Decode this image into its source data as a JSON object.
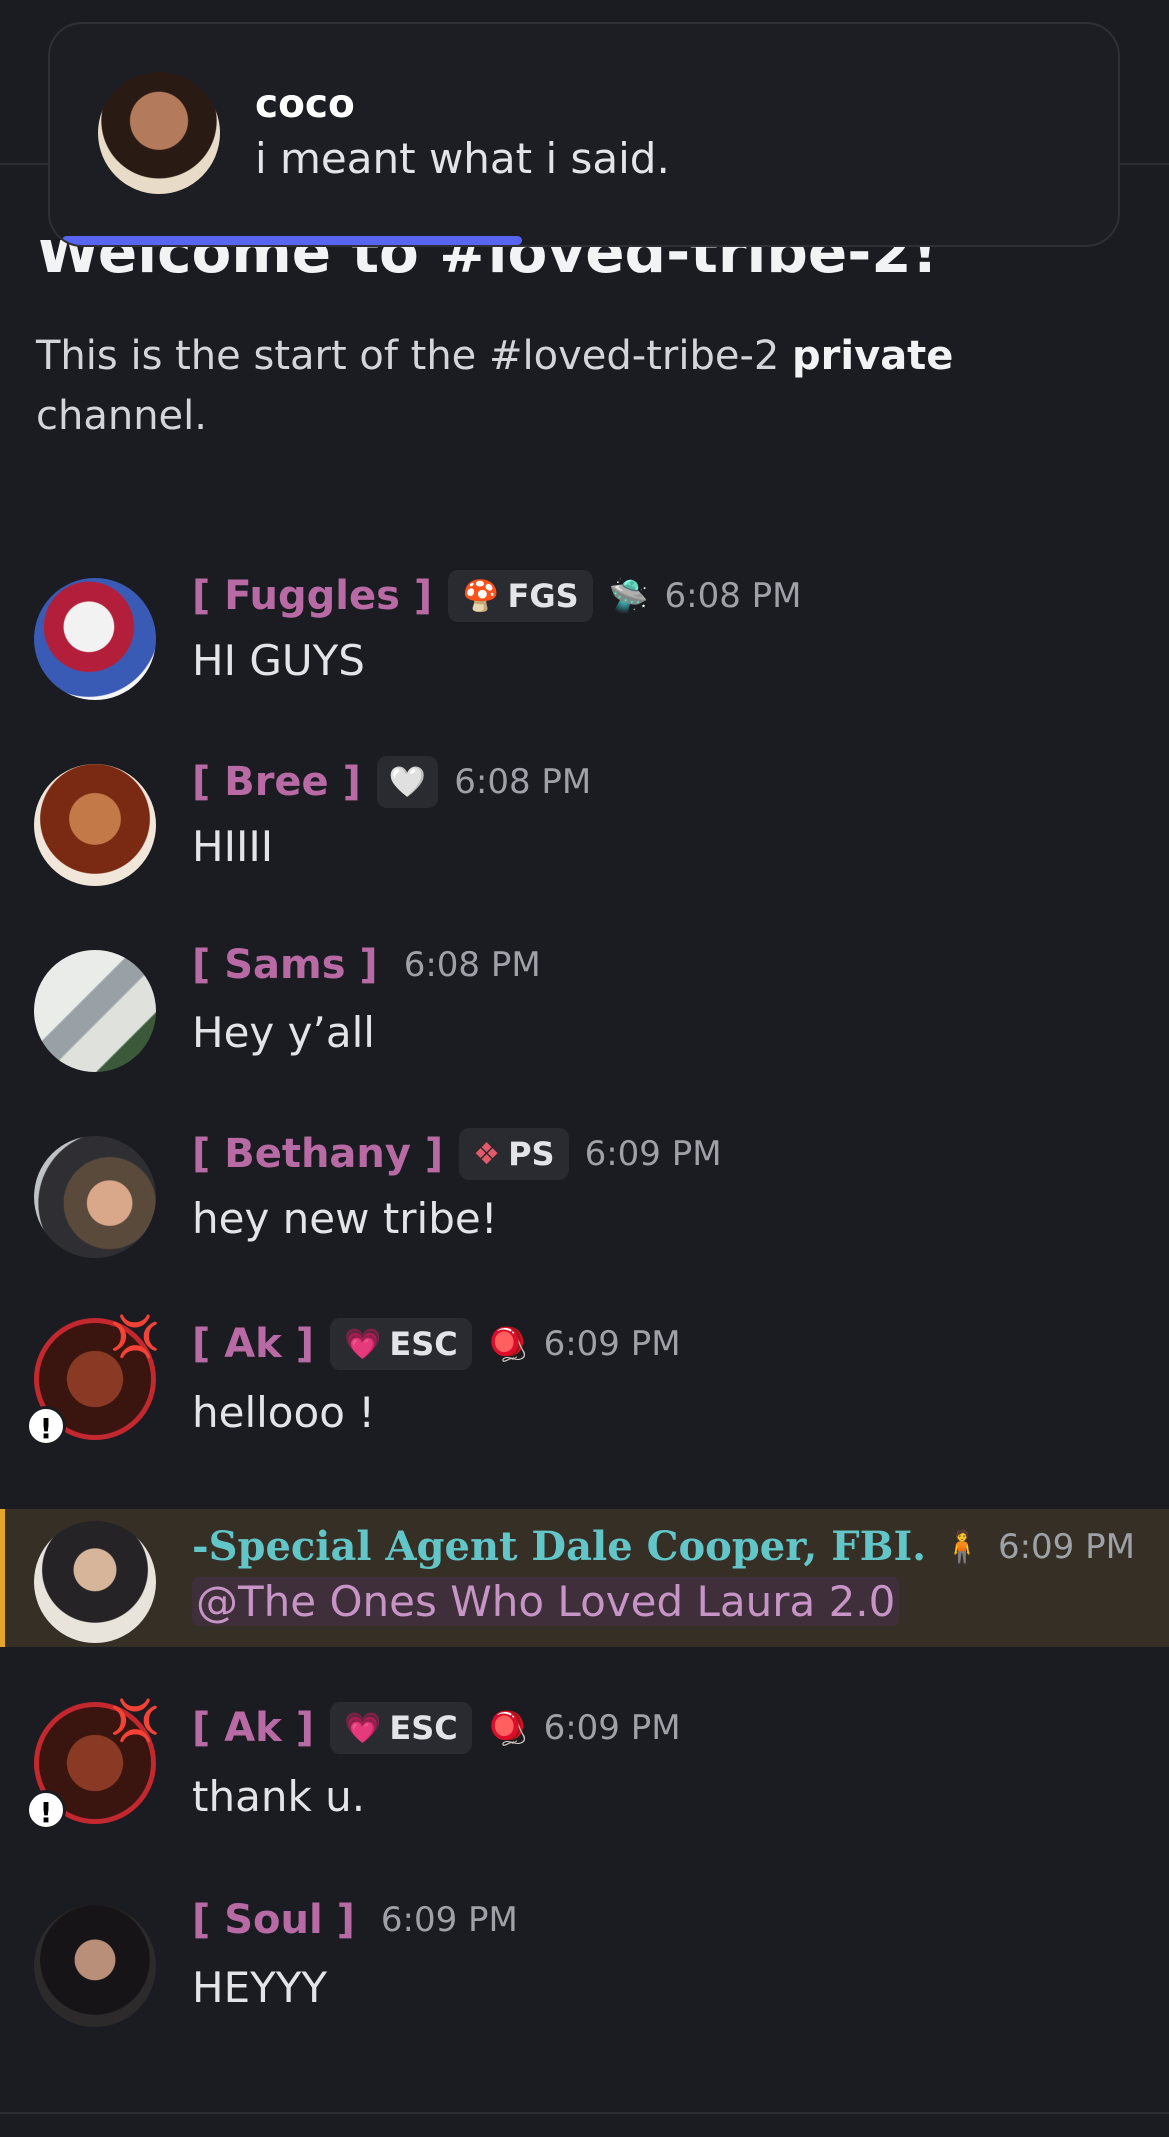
{
  "toast": {
    "name": "coco",
    "text": "i meant what i said."
  },
  "welcome": {
    "title": "Welcome to #loved-tribe-2!",
    "desc_prefix": "This is the start of the #loved-tribe-2 ",
    "desc_bold": "private",
    "desc_suffix": " channel."
  },
  "messages": [
    {
      "name": "[ Fuggles ]",
      "tag": "FGS",
      "tag_icon": "🍄",
      "badge": "🛸",
      "time": "6:08 PM",
      "text": "HI GUYS"
    },
    {
      "name": "[ Bree ]",
      "tag_icon": "🤍",
      "time": "6:08 PM",
      "text": "HIIII"
    },
    {
      "name": "[ Sams ]",
      "time": "6:08 PM",
      "text": "Hey y’all"
    },
    {
      "name": "[ Bethany ]",
      "tag": "PS",
      "tag_icon": "❖",
      "time": "6:09 PM",
      "text": "hey new tribe!"
    },
    {
      "name": "[ Ak ]",
      "tag": "ESC",
      "tag_icon": "💗",
      "badge": "🪀",
      "time": "6:09 PM",
      "text": "hellooo !"
    },
    {
      "name": "-Special Agent Dale Cooper, FBI.",
      "badge": "🧍",
      "time": "6:09 PM",
      "mention": "@The Ones Who Loved Laura 2.0"
    },
    {
      "name": "[ Ak ]",
      "tag": "ESC",
      "tag_icon": "💗",
      "badge": "🪀",
      "time": "6:09 PM",
      "text": "thank u."
    },
    {
      "name": "[ Soul ]",
      "time": "6:09 PM",
      "text": "HEYYY"
    }
  ],
  "icons": {
    "anger": "💢",
    "alert": "!"
  },
  "colors": {
    "name_pink": "#b86aa5",
    "name_cyan": "#62c6c8",
    "highlight_bar": "#e3a52b",
    "toast_progress": "#5865f2"
  }
}
